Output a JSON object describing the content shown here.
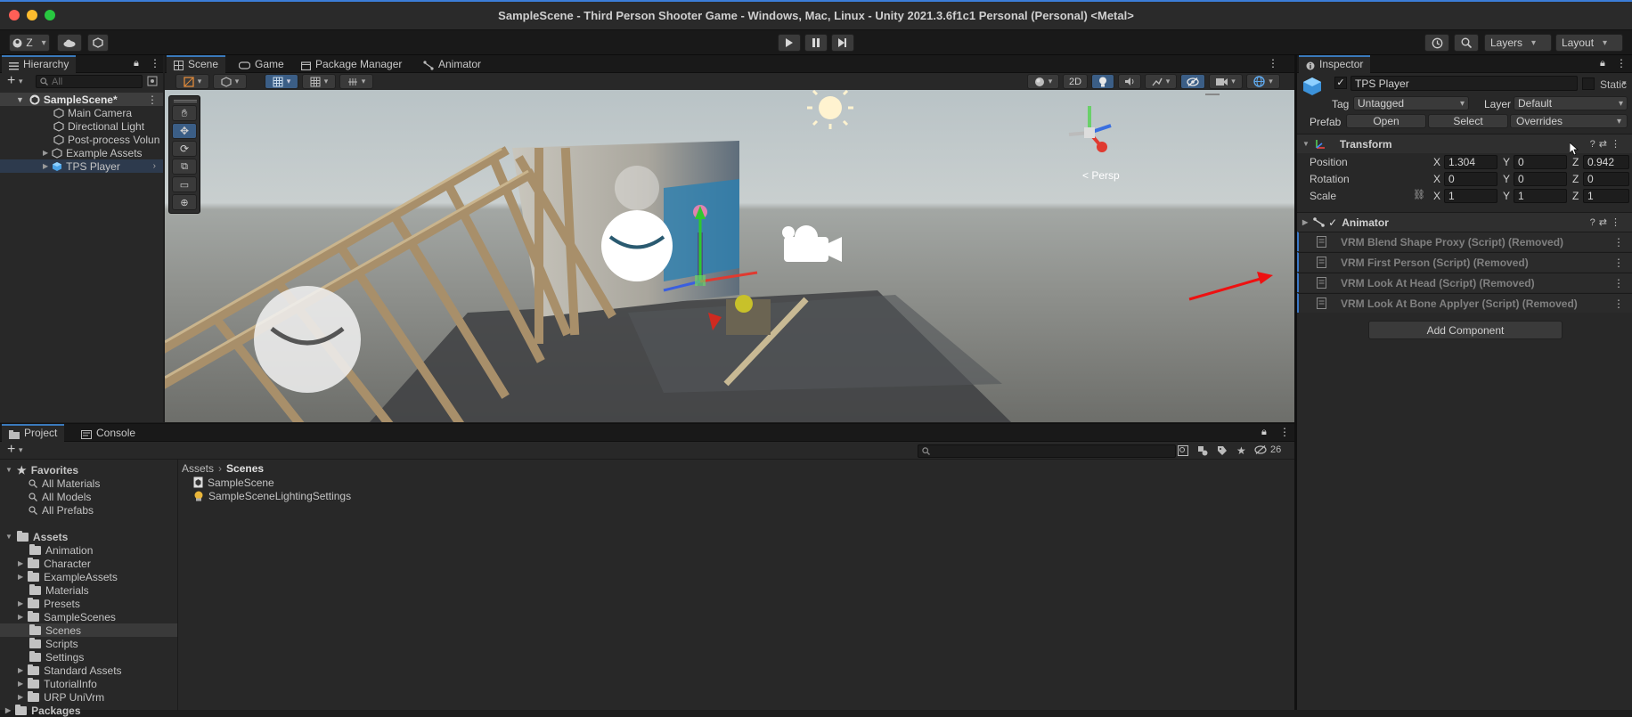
{
  "window": {
    "title": "SampleScene - Third Person Shooter Game - Windows, Mac, Linux - Unity 2021.3.6f1c1 Personal (Personal) <Metal>"
  },
  "toolbar": {
    "account_label": "Z",
    "layers_label": "Layers",
    "layout_label": "Layout"
  },
  "hierarchy": {
    "tab": "Hierarchy",
    "search_placeholder": "All",
    "scene_name": "SampleScene*",
    "items": [
      "Main Camera",
      "Directional Light",
      "Post-process Volun",
      "Example Assets",
      "TPS Player"
    ]
  },
  "scene_tabs": [
    "Scene",
    "Game",
    "Package Manager",
    "Animator"
  ],
  "scene": {
    "mode_2d": "2D",
    "persp_label": "< Persp"
  },
  "inspector": {
    "tab": "Inspector",
    "object_name": "TPS Player",
    "static_label": "Static",
    "tag_label": "Tag",
    "tag_value": "Untagged",
    "layer_label": "Layer",
    "layer_value": "Default",
    "prefab_label": "Prefab",
    "open_label": "Open",
    "select_label": "Select",
    "overrides_label": "Overrides",
    "transform": {
      "title": "Transform",
      "position_label": "Position",
      "position": {
        "x": "1.304",
        "y": "0",
        "z": "0.942"
      },
      "rotation_label": "Rotation",
      "rotation": {
        "x": "0",
        "y": "0",
        "z": "0"
      },
      "scale_label": "Scale",
      "scale": {
        "x": "1",
        "y": "1",
        "z": "1"
      },
      "x_label": "X",
      "y_label": "Y",
      "z_label": "Z"
    },
    "animator_title": "Animator",
    "removed_components": [
      "VRM Blend Shape Proxy (Script) (Removed)",
      "VRM First Person (Script) (Removed)",
      "VRM Look At Head (Script) (Removed)",
      "VRM Look At Bone Applyer (Script) (Removed)"
    ],
    "add_component_label": "Add Component"
  },
  "project": {
    "tabs": [
      "Project",
      "Console"
    ],
    "hidden_count": "26",
    "favorites_label": "Favorites",
    "favorites": [
      "All Materials",
      "All Models",
      "All Prefabs"
    ],
    "assets_label": "Assets",
    "folders": [
      "Animation",
      "Character",
      "ExampleAssets",
      "Materials",
      "Presets",
      "SampleScenes",
      "Scenes",
      "Scripts",
      "Settings",
      "Standard Assets",
      "TutorialInfo",
      "URP UniVrm"
    ],
    "packages_label": "Packages",
    "breadcrumb_root": "Assets",
    "breadcrumb_current": "Scenes",
    "files": [
      "SampleScene",
      "SampleSceneLightingSettings"
    ]
  }
}
